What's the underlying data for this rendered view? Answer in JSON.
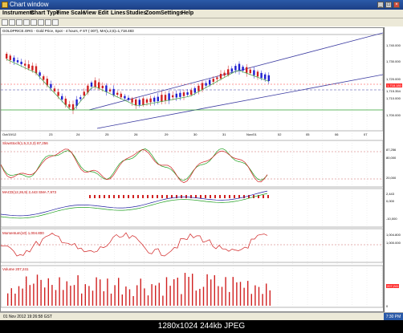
{
  "window": {
    "title": "Chart window",
    "clock": "7:30 PM"
  },
  "menu": [
    "Instruments",
    "Chart Type",
    "Time Scale",
    "View",
    "Edit",
    "Lines",
    "Studies",
    "Zoom",
    "Settings",
    "Help"
  ],
  "chart": {
    "header": "GOLDPRICE.ORG - Gold Price, Spot - 4 hours, # ST (-307), MA(x,2,5)=1,718.483",
    "dates": [
      "Oct/19/12",
      "23",
      "24",
      "25",
      "26",
      "29",
      "30",
      "31",
      "Nov/01",
      "02",
      "05",
      "06",
      "07"
    ],
    "price_labels": [
      "1,740.000",
      "1,730.000",
      "1,720.000",
      "1,715.354",
      "1,710.000",
      "1,700.000"
    ],
    "last_price": "1,718.180",
    "panels": {
      "stoch": {
        "title": "SlowStoch(1,5,3,3,3) 87,256",
        "labels": [
          "87,256",
          "80,000",
          "20,000"
        ]
      },
      "macd": {
        "title": "MACD(12,26,9) 2,443 SMA 7,973",
        "labels": [
          "2,443",
          "0,000",
          "-10,000"
        ]
      },
      "mom": {
        "title": "Momentum(10) 1,004.800",
        "labels": [
          "1,004.800",
          "1,000.000"
        ]
      },
      "vol": {
        "title": "Volume 207,241",
        "labels": [
          "207,241",
          "0"
        ]
      }
    }
  },
  "status": {
    "text": "01 Nov 2012 19:26:58 GST"
  },
  "caption": {
    "size": "1280x1024",
    "filesize": "244kb",
    "format": "JPEG"
  }
}
